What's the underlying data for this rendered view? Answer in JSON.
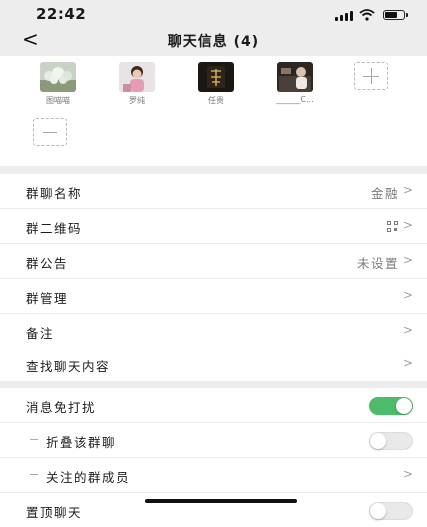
{
  "status_bar": {
    "time": "22:42"
  },
  "nav": {
    "back": "<",
    "title": "聊天信息 (4)"
  },
  "members": [
    {
      "name": "图喵喵"
    },
    {
      "name": "罗纯"
    },
    {
      "name": "任贵"
    },
    {
      "name": "______C..."
    }
  ],
  "section1": [
    {
      "label": "群聊名称",
      "value": "金融"
    },
    {
      "label": "群二维码",
      "value": ""
    },
    {
      "label": "群公告",
      "value": "未设置"
    },
    {
      "label": "群管理",
      "value": ""
    },
    {
      "label": "备注",
      "value": ""
    }
  ],
  "section2": [
    {
      "label": "查找聊天内容"
    }
  ],
  "section3": [
    {
      "label": "消息免打扰",
      "toggle": "on"
    },
    {
      "label": "折叠该群聊",
      "toggle": "off"
    },
    {
      "label": "关注的群成员"
    },
    {
      "label": "置顶聊天",
      "toggle": "off"
    }
  ],
  "chevron": ">",
  "colors": {
    "toggle_on": "#4cbb6a",
    "background": "#ededed"
  }
}
